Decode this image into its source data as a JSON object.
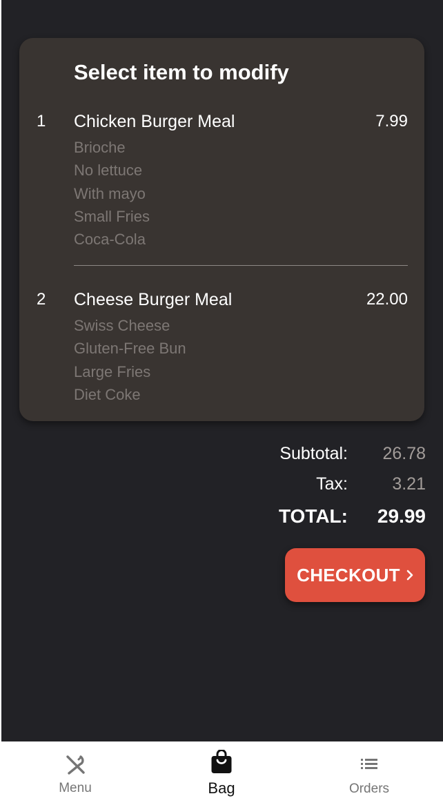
{
  "card": {
    "title": "Select item to modify",
    "items": [
      {
        "number": "1",
        "name": "Chicken Burger Meal",
        "price": "7.99",
        "modifiers": [
          "Brioche",
          "No lettuce",
          "With mayo",
          "Small Fries",
          "Coca-Cola"
        ]
      },
      {
        "number": "2",
        "name": "Cheese Burger Meal",
        "price": "22.00",
        "modifiers": [
          "Swiss Cheese",
          "Gluten-Free Bun",
          "Large Fries",
          "Diet Coke"
        ]
      }
    ]
  },
  "totals": {
    "subtotal_label": "Subtotal:",
    "subtotal_value": "26.78",
    "tax_label": "Tax:",
    "tax_value": "3.21",
    "total_label": "TOTAL:",
    "total_value": "29.99"
  },
  "checkout": {
    "label": "CHECKOUT",
    "icon": "chevron-right-icon",
    "color": "#df503e"
  },
  "nav": {
    "items": [
      {
        "label": "Menu",
        "icon": "fork-knife-icon",
        "active": false
      },
      {
        "label": "Bag",
        "icon": "shopping-bag-icon",
        "active": true
      },
      {
        "label": "Orders",
        "icon": "list-icon",
        "active": false
      }
    ]
  },
  "colors": {
    "background": "#222226",
    "card": "#393431",
    "accent": "#df503e",
    "muted_text": "#7d7774",
    "nav_inactive": "#757575",
    "nav_active": "#111111"
  }
}
